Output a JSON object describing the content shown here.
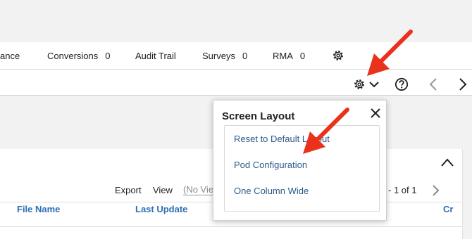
{
  "tabs": [
    {
      "label": "ance",
      "count": ""
    },
    {
      "label": "Conversions",
      "count": "0"
    },
    {
      "label": "Audit Trail",
      "count": ""
    },
    {
      "label": "Surveys",
      "count": "0"
    },
    {
      "label": "RMA",
      "count": "0"
    }
  ],
  "listing": {
    "export_label": "Export",
    "view_label": "View",
    "view_value": "(No View)",
    "pager_text": "- 1 of 1",
    "columns": [
      "File Name",
      "Last Update",
      "Cr"
    ]
  },
  "popup": {
    "title": "Screen Layout",
    "items": [
      "Reset to Default Layout",
      "Pod Configuration",
      "One Column Wide"
    ]
  },
  "colors": {
    "link": "#2d6fb4",
    "menu_link": "#2b5c8a",
    "annotation_arrow": "#e8321c"
  }
}
